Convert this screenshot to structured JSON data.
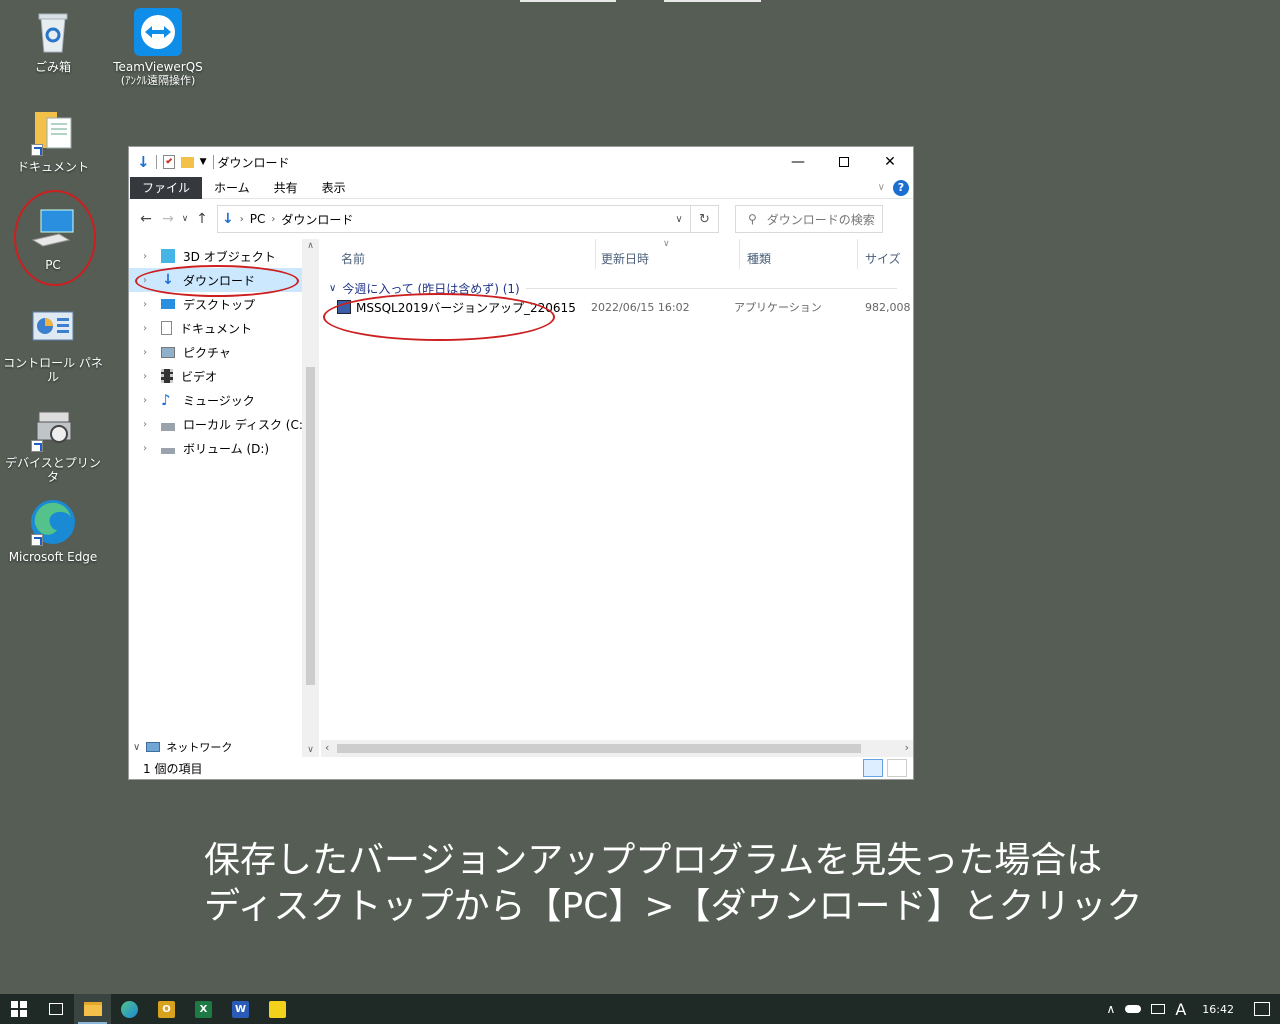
{
  "desktop": {
    "icons": [
      {
        "label": "ごみ箱",
        "icon": "recycle-bin-icon"
      },
      {
        "label": "TeamViewerQS",
        "sublabel": "(ｱﾝｸﾙ遠隔操作)",
        "icon": "teamviewer-icon"
      },
      {
        "label": "ドキュメント",
        "icon": "documents-icon"
      },
      {
        "label": "PC",
        "icon": "pc-icon"
      },
      {
        "label": "コントロール パネル",
        "icon": "control-panel-icon"
      },
      {
        "label": "デバイスとプリンタ",
        "icon": "devices-printers-icon"
      },
      {
        "label": "Microsoft Edge",
        "icon": "edge-icon"
      }
    ]
  },
  "window": {
    "title": "ダウンロード",
    "ribbon_tabs": [
      "ファイル",
      "ホーム",
      "共有",
      "表示"
    ],
    "help": "?",
    "address": {
      "crumbs": [
        "PC",
        "ダウンロード"
      ]
    },
    "search_placeholder": "ダウンロードの検索",
    "nav_items": [
      {
        "label": "3D オブジェクト",
        "icon": "3d-objects-icon"
      },
      {
        "label": "ダウンロード",
        "icon": "download-icon"
      },
      {
        "label": "デスクトップ",
        "icon": "desktop-folder-icon"
      },
      {
        "label": "ドキュメント",
        "icon": "document-folder-icon"
      },
      {
        "label": "ピクチャ",
        "icon": "pictures-icon"
      },
      {
        "label": "ビデオ",
        "icon": "videos-icon"
      },
      {
        "label": "ミュージック",
        "icon": "music-icon"
      },
      {
        "label": "ローカル ディスク (C:)",
        "icon": "local-disk-icon"
      },
      {
        "label": "ボリューム (D:)",
        "icon": "volume-icon"
      }
    ],
    "network_label": "ネットワーク",
    "columns": [
      "名前",
      "更新日時",
      "種類",
      "サイズ"
    ],
    "group_label": "今週に入って (昨日は含めず) (1)",
    "files": [
      {
        "name": "MSSQL2019バージョンアップ_220615",
        "date": "2022/06/15 16:02",
        "type": "アプリケーション",
        "size": "982,008"
      }
    ],
    "status": "1 個の項目"
  },
  "caption": {
    "line1": "保存したバージョンアッププログラムを見失った場合は",
    "line2": "ディスクトップから【PC】>【ダウンロード】とクリック"
  },
  "taskbar": {
    "apps": [
      "start",
      "task-view",
      "file-explorer",
      "edge",
      "outlook",
      "excel",
      "word",
      "sticky-notes"
    ],
    "ime": "A",
    "time": "16:42"
  },
  "colors": {
    "desktop_bg": "#555d55",
    "annotation_red": "#cc1f1f",
    "selection_blue": "#cce8ff",
    "taskbar_bg": "#1f2a27"
  }
}
